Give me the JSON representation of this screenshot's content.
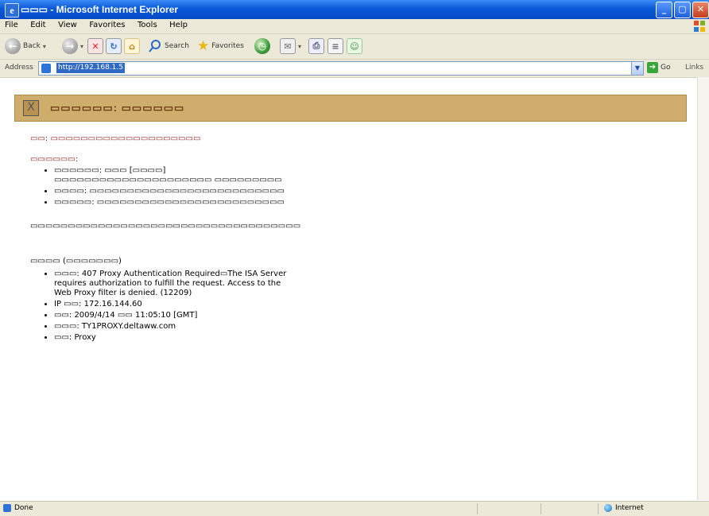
{
  "window": {
    "title": "▭▭▭ - Microsoft Internet Explorer",
    "min_label": "_",
    "max_label": "▢",
    "close_label": "✕"
  },
  "menu": [
    "File",
    "Edit",
    "View",
    "Favorites",
    "Tools",
    "Help"
  ],
  "toolbar": {
    "back_label": "Back",
    "search_label": "Search",
    "favorites_label": "Favorites"
  },
  "address": {
    "label": "Address",
    "url": "http://192.168.1.5",
    "go_label": "Go",
    "links_label": "Links"
  },
  "page": {
    "header_icon": "X",
    "header_title": "▭▭▭▭▭▭: ▭▭▭▭▭▭",
    "line1": "▭▭: ▭▭▭▭▭▭▭▭▭▭▭▭▭▭▭▭▭▭▭▭",
    "section_title": "▭▭▭▭▭▭:",
    "reasons": [
      "▭▭▭▭▭▭: ▭▭▭ [▭▭▭▭] ▭▭▭▭▭▭▭▭▭▭▭▭▭▭▭▭▭▭▭▭▭ ▭▭▭▭▭▭▭▭▭",
      "▭▭▭▭: ▭▭▭▭▭▭▭▭▭▭▭▭▭▭▭▭▭▭▭▭▭▭▭▭▭▭",
      "▭▭▭▭▭: ▭▭▭▭▭▭▭▭▭▭▭▭▭▭▭▭▭▭▭▭▭▭▭▭▭"
    ],
    "line2": "▭▭▭▭▭▭▭▭▭▭▭▭▭▭▭▭▭▭▭▭▭▭▭▭▭▭▭▭▭▭▭▭▭▭▭▭",
    "tech_title": "▭▭▭▭ (▭▭▭▭▭▭▭)",
    "tech": [
      "▭▭▭: 407 Proxy Authentication Required▭The ISA Server requires authorization to fulfill the request. Access to the Web Proxy filter is denied. (12209)",
      "IP ▭▭: 172.16.144.60",
      "▭▭: 2009/4/14 ▭▭ 11:05:10 [GMT]",
      "▭▭▭: TY1PROXY.deltaww.com",
      "▭▭: Proxy"
    ]
  },
  "status": {
    "left": "Done",
    "zone": "Internet"
  }
}
